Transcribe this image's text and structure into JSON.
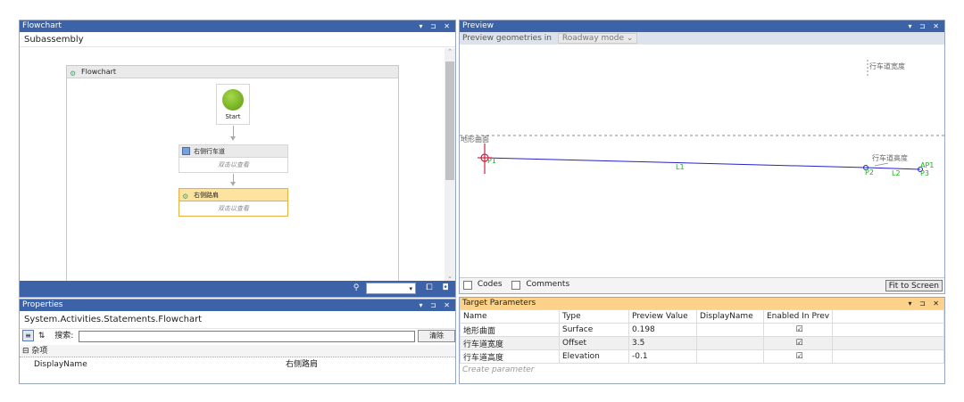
{
  "flowchart_pane": {
    "title": "Flowchart",
    "title_controls": "▾ ⊐ ✕",
    "breadcrumb": "Subassembly",
    "designer_title": "Flowchart",
    "start_label": "Start",
    "activities": [
      {
        "title": "右侧行车道",
        "hint": "双击以查看"
      },
      {
        "title": "右侧路肩",
        "hint": "双击以查看"
      }
    ]
  },
  "properties_pane": {
    "title": "Properties",
    "title_controls": "▾ ⊐ ✕",
    "object_name": "System.Activities.Statements.Flowchart",
    "search_label": "搜索:",
    "search_value": "",
    "clear_button": "清除",
    "category": "杂项",
    "category_toggle": "⊟",
    "props": [
      {
        "name": "DisplayName",
        "value": "右侧路肩"
      }
    ]
  },
  "preview_pane": {
    "title": "Preview",
    "title_controls": "▾ ⊐ ✕",
    "mode_label": "Preview geometries in",
    "mode_value": "Roadway mode",
    "codes_label": "Codes",
    "comments_label": "Comments",
    "fit_button": "Fit to Screen",
    "labels": {
      "surface": "地形曲面",
      "width": "行车道宽度",
      "elevation": "行车道高度",
      "p1": "P1",
      "l1": "L1",
      "p2": "P2",
      "l2": "L2",
      "p3": "P3",
      "ap1": "AP1"
    },
    "colors": {
      "link": "#2222cc",
      "point": "#22aa22",
      "origin": "#cc2244"
    }
  },
  "target_pane": {
    "title": "Target Parameters",
    "title_controls": "▾ ⊐ ✕",
    "columns": [
      "Name",
      "Type",
      "Preview Value",
      "DisplayName",
      "Enabled In Prev"
    ],
    "rows": [
      {
        "name": "地形曲面",
        "type": "Surface",
        "value": "0.198",
        "display": "",
        "enabled": true
      },
      {
        "name": "行车道宽度",
        "type": "Offset",
        "value": "3.5",
        "display": "",
        "enabled": true
      },
      {
        "name": "行车道高度",
        "type": "Elevation",
        "value": "-0.1",
        "display": "",
        "enabled": true
      }
    ],
    "create_placeholder": "Create parameter"
  }
}
